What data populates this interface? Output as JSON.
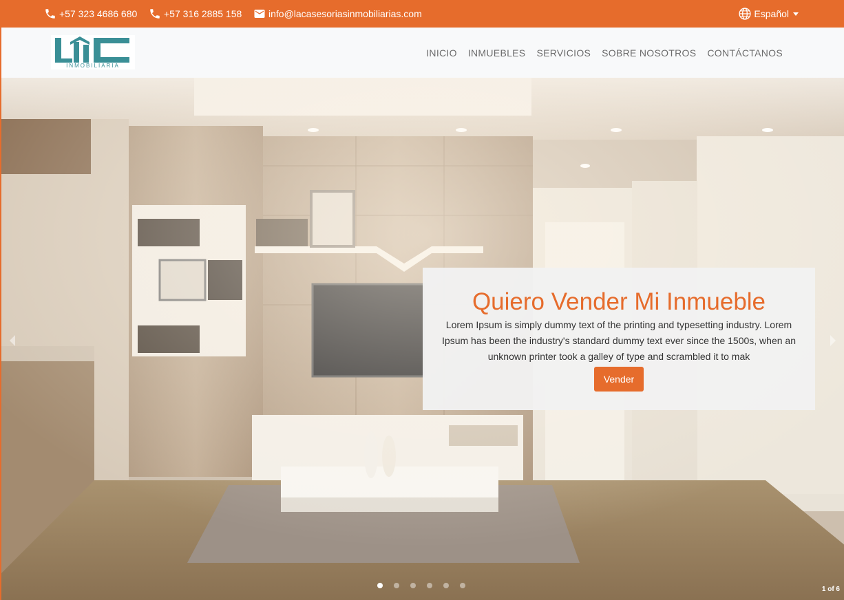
{
  "topbar": {
    "phone1": "+57 323 4686 680",
    "phone2": "+57 316 2885 158",
    "email": "info@lacasesoriasinmobiliarias.com",
    "language": "Español"
  },
  "nav": {
    "logo_text": "INMOBILIARIA",
    "items": [
      {
        "label": "INICIO"
      },
      {
        "label": "INMUEBLES"
      },
      {
        "label": "SERVICIOS"
      },
      {
        "label": "SOBRE NOSOTROS"
      },
      {
        "label": "CONTÁCTANOS"
      }
    ]
  },
  "hero": {
    "title": "Quiero Vender Mi Inmueble",
    "body": "Lorem Ipsum is simply dummy text of the printing and typesetting industry. Lorem Ipsum has been the industry's standard dummy text ever since the 1500s, when an unknown printer took a galley of type and scrambled it to mak",
    "button": "Vender",
    "counter": "1 of 6",
    "slide_count": 6,
    "active_slide": 1
  },
  "colors": {
    "accent": "#e66c2c",
    "logo": "#3a8f96"
  },
  "icons": [
    "phone-icon",
    "mail-icon",
    "globe-icon",
    "chevron-left-icon",
    "chevron-right-icon"
  ]
}
